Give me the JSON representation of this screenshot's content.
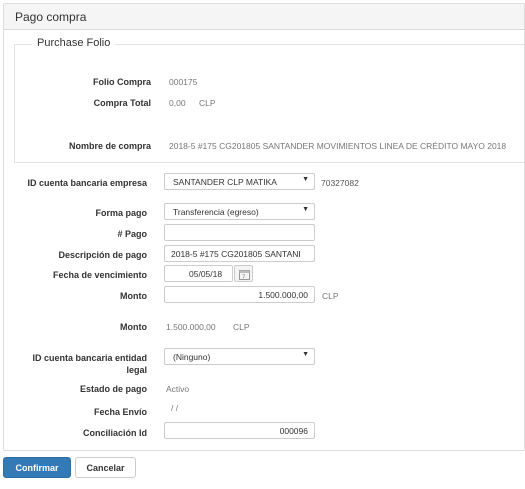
{
  "panel": {
    "title": "Pago compra"
  },
  "folio": {
    "legend": "Purchase Folio",
    "folio_compra_label": "Folio Compra",
    "folio_compra_value": "000175",
    "compra_total_label": "Compra Total",
    "compra_total_value": "0,00",
    "compra_total_currency": "CLP",
    "nombre_label": "Nombre de compra",
    "nombre_value": "2018-5 #175 CG201805 SANTANDER MOVIMIENTOS LINEA DE CRÉDITO MAYO 2018"
  },
  "form": {
    "cuenta_empresa_label": "ID cuenta bancaria empresa",
    "cuenta_empresa_value": "SANTANDER CLP MATIKA",
    "cuenta_empresa_number": "70327082",
    "forma_pago_label": "Forma pago",
    "forma_pago_value": "Transferencia (egreso)",
    "num_pago_label": "# Pago",
    "num_pago_value": "",
    "descripcion_label": "Descripción de pago",
    "descripcion_value": "2018-5 #175 CG201805 SANTANI",
    "fecha_venc_label": "Fecha de vencimiento",
    "fecha_venc_value": "05/05/18",
    "monto_label": "Monto",
    "monto_value": "1.500.000,00",
    "monto_currency": "CLP",
    "monto2_label": "Monto",
    "monto2_value": "1.500.000,00",
    "monto2_currency": "CLP",
    "cuenta_legal_label_1": "ID cuenta bancaria entidad",
    "cuenta_legal_label_2": "legal",
    "cuenta_legal_value": "(Ninguno)",
    "estado_label": "Estado de pago",
    "estado_value": "Activo",
    "fecha_envio_label": "Fecha Envío",
    "fecha_envio_value": "/ /",
    "conciliacion_label": "Conciliación Id",
    "conciliacion_value": "000096"
  },
  "actions": {
    "confirm_label": "Confirmar",
    "cancel_label": "Cancelar"
  },
  "colors": {
    "primary": "#337ab7",
    "panel_header": "#f5f5f5",
    "border": "#dddddd"
  },
  "icons": {
    "calendar": "calendar-icon",
    "dropdown": "chevron-down-icon"
  }
}
